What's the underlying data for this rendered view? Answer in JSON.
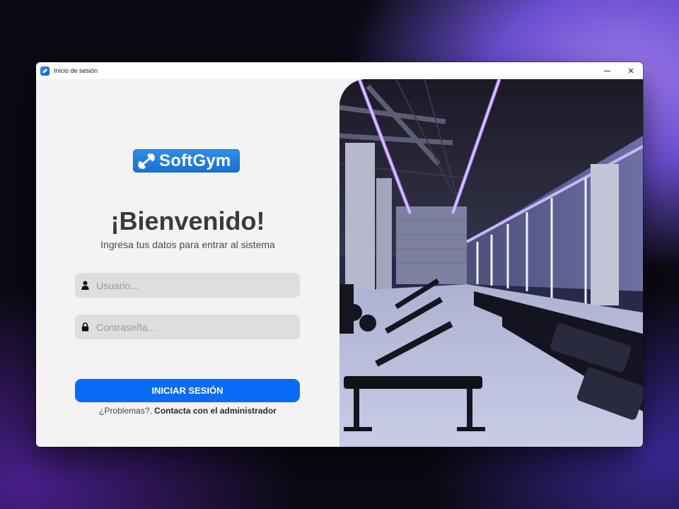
{
  "window": {
    "title": "Inicio de sesión",
    "controls": {
      "minimize": "—",
      "close": "✕"
    }
  },
  "brand": {
    "logo_text": "SoftGym",
    "logo_icon": "dumbbell-icon",
    "color": "#1f7be0"
  },
  "login": {
    "heading": "¡Bienvenido!",
    "subtitle": "Ingresa tus datos para entrar al sistema",
    "username": {
      "icon": "user-icon",
      "value": "",
      "placeholder": "Usuario..."
    },
    "password": {
      "icon": "lock-icon",
      "value": "",
      "placeholder": "Contraseña..."
    },
    "submit_label": "INICIAR SESIÓN",
    "help_text": "¿Problemas?, ",
    "help_link": "Contacta con el administrador",
    "accent_color": "#0a6cf5"
  },
  "hero": {
    "image": "gym-interior-image"
  }
}
